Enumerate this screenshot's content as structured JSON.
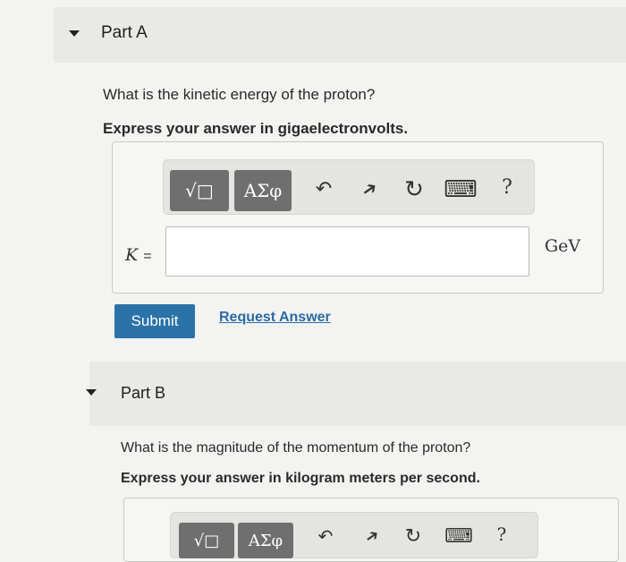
{
  "part_a": {
    "title": "Part A",
    "question": "What is the kinetic energy of the proton?",
    "instruction": "Express your answer in gigaelectronvolts.",
    "toolbar": {
      "template_label": "√□",
      "greek_label": "ΑΣφ",
      "undo_icon": "↶",
      "redo_icon": "➔",
      "reset_icon": "↻",
      "keyboard_icon": "⌨",
      "help_label": "?"
    },
    "variable": "K",
    "equals": "=",
    "input_value": "",
    "unit": "GeV",
    "submit_label": "Submit",
    "request_label": "Request Answer"
  },
  "part_b": {
    "title": "Part B",
    "question": "What is the magnitude of the momentum of the proton?",
    "instruction": "Express your answer in kilogram meters per second.",
    "toolbar": {
      "template_label": "√□",
      "greek_label": "ΑΣφ",
      "undo_icon": "↶",
      "redo_icon": "➔",
      "reset_icon": "↻",
      "keyboard_icon": "⌨",
      "help_label": "?"
    }
  }
}
